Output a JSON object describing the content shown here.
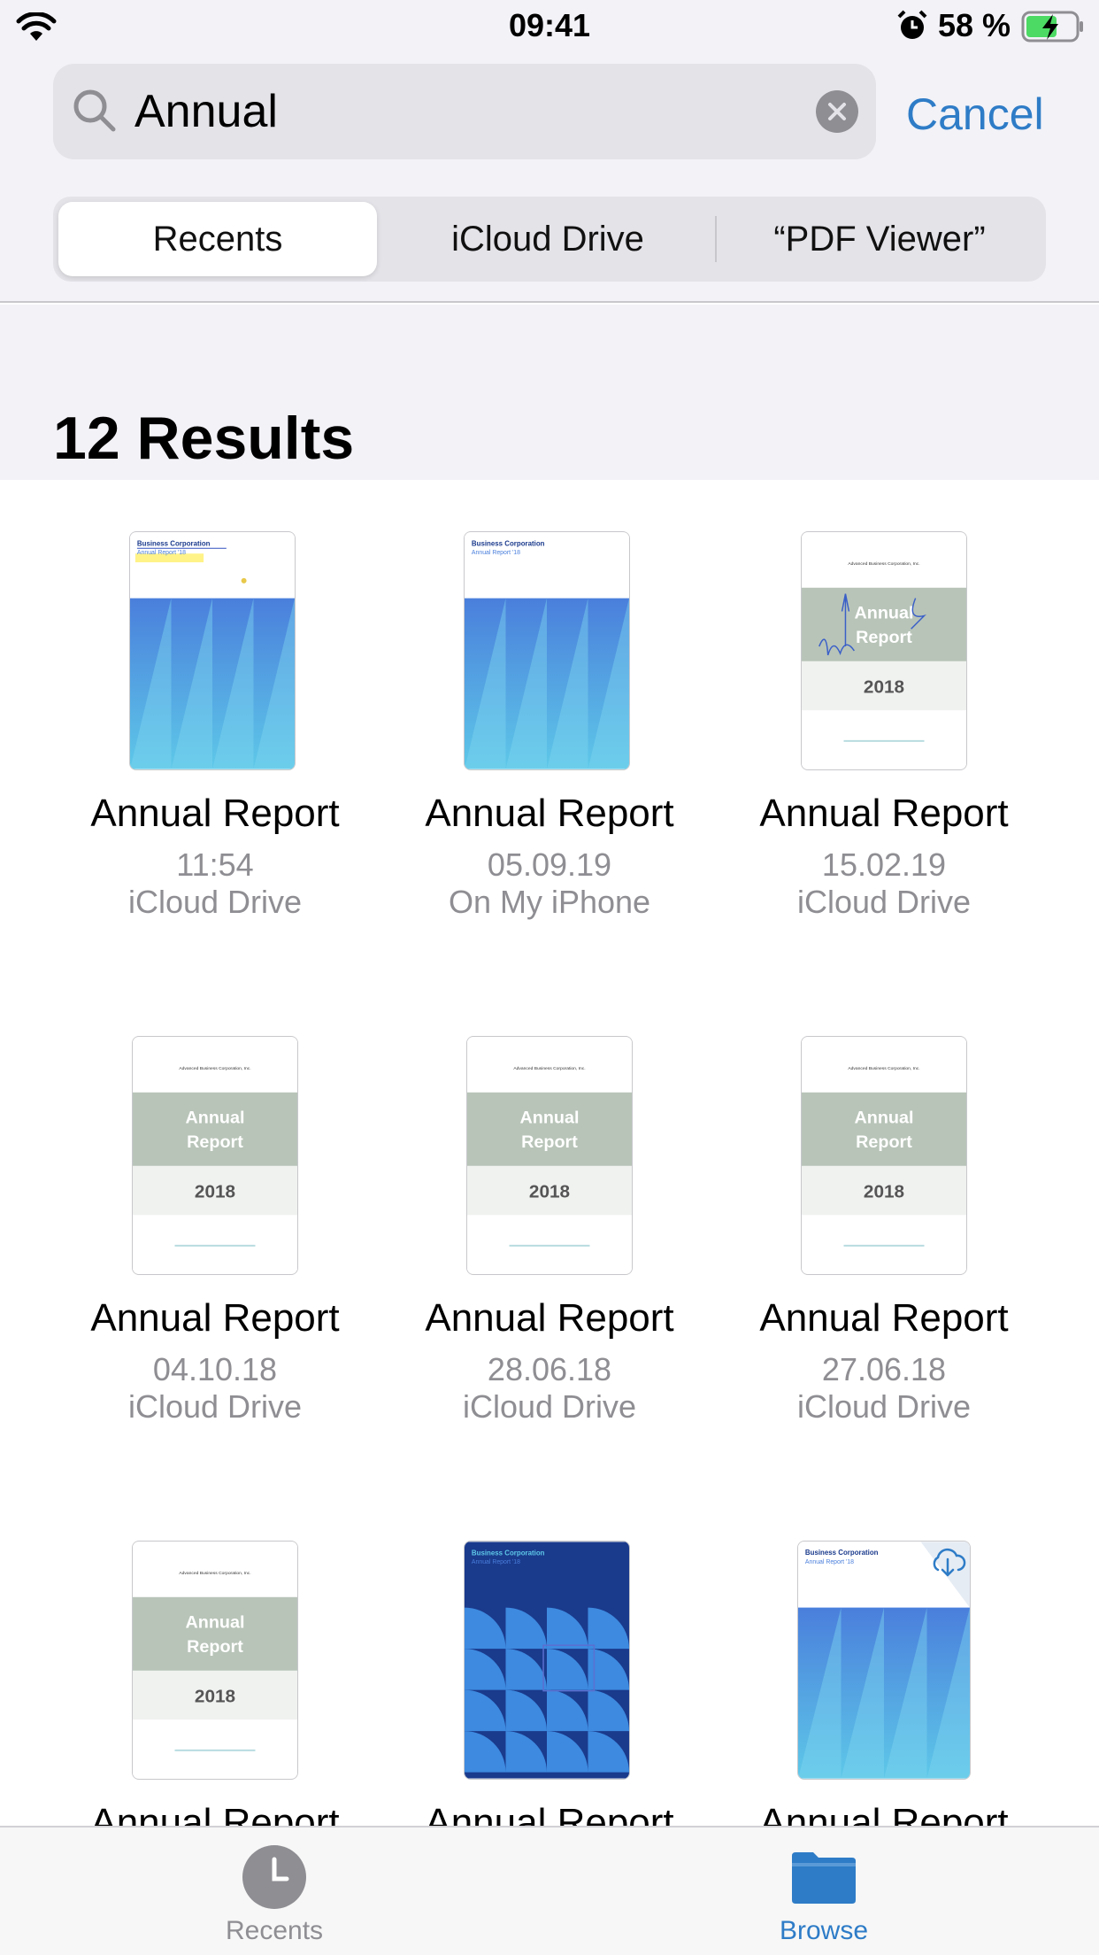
{
  "status_bar": {
    "time": "09:41",
    "battery_percent": "58 %"
  },
  "search": {
    "query": "Annual",
    "cancel_label": "Cancel"
  },
  "scope_tabs": [
    {
      "label": "Recents",
      "selected": true
    },
    {
      "label": "iCloud Drive",
      "selected": false
    },
    {
      "label": "“PDF Viewer”",
      "selected": false
    }
  ],
  "results": {
    "heading": "12 Results",
    "items": [
      {
        "name": "Annual Report",
        "date": "11:54",
        "location": "iCloud Drive",
        "thumbnail": "blue-cover-highlighted"
      },
      {
        "name": "Annual Report",
        "date": "05.09.19",
        "location": "On My iPhone",
        "thumbnail": "blue-cover"
      },
      {
        "name": "Annual Report",
        "date": "15.02.19",
        "location": "iCloud Drive",
        "thumbnail": "green-cover-annotated"
      },
      {
        "name": "Annual Report",
        "date": "04.10.18",
        "location": "iCloud Drive",
        "thumbnail": "green-cover"
      },
      {
        "name": "Annual Report",
        "date": "28.06.18",
        "location": "iCloud Drive",
        "thumbnail": "green-cover"
      },
      {
        "name": "Annual Report",
        "date": "27.06.18",
        "location": "iCloud Drive",
        "thumbnail": "green-cover"
      },
      {
        "name": "Annual Report",
        "date": "",
        "location": "",
        "thumbnail": "green-cover"
      },
      {
        "name": "Annual Report",
        "date": "",
        "location": "",
        "thumbnail": "navy-pattern-cover"
      },
      {
        "name": "Annual Report",
        "date": "",
        "location": "",
        "thumbnail": "blue-cover-cloud-download"
      }
    ]
  },
  "thumb_text": {
    "company": "Business Corporation",
    "subtitle": "Annual Report '18",
    "company_long": "Advanced Business Corporation, Inc.",
    "cover_line1": "Annual",
    "cover_line2": "Report",
    "cover_year": "2018"
  },
  "tab_bar": [
    {
      "label": "Recents",
      "icon": "clock-icon",
      "active": false
    },
    {
      "label": "Browse",
      "icon": "folder-icon",
      "active": true
    }
  ],
  "colors": {
    "accent": "#2e7cc7",
    "inactive": "#8e8e93",
    "cover_green": "#b8c4b8",
    "cover_navy": "#1a3a8c"
  }
}
